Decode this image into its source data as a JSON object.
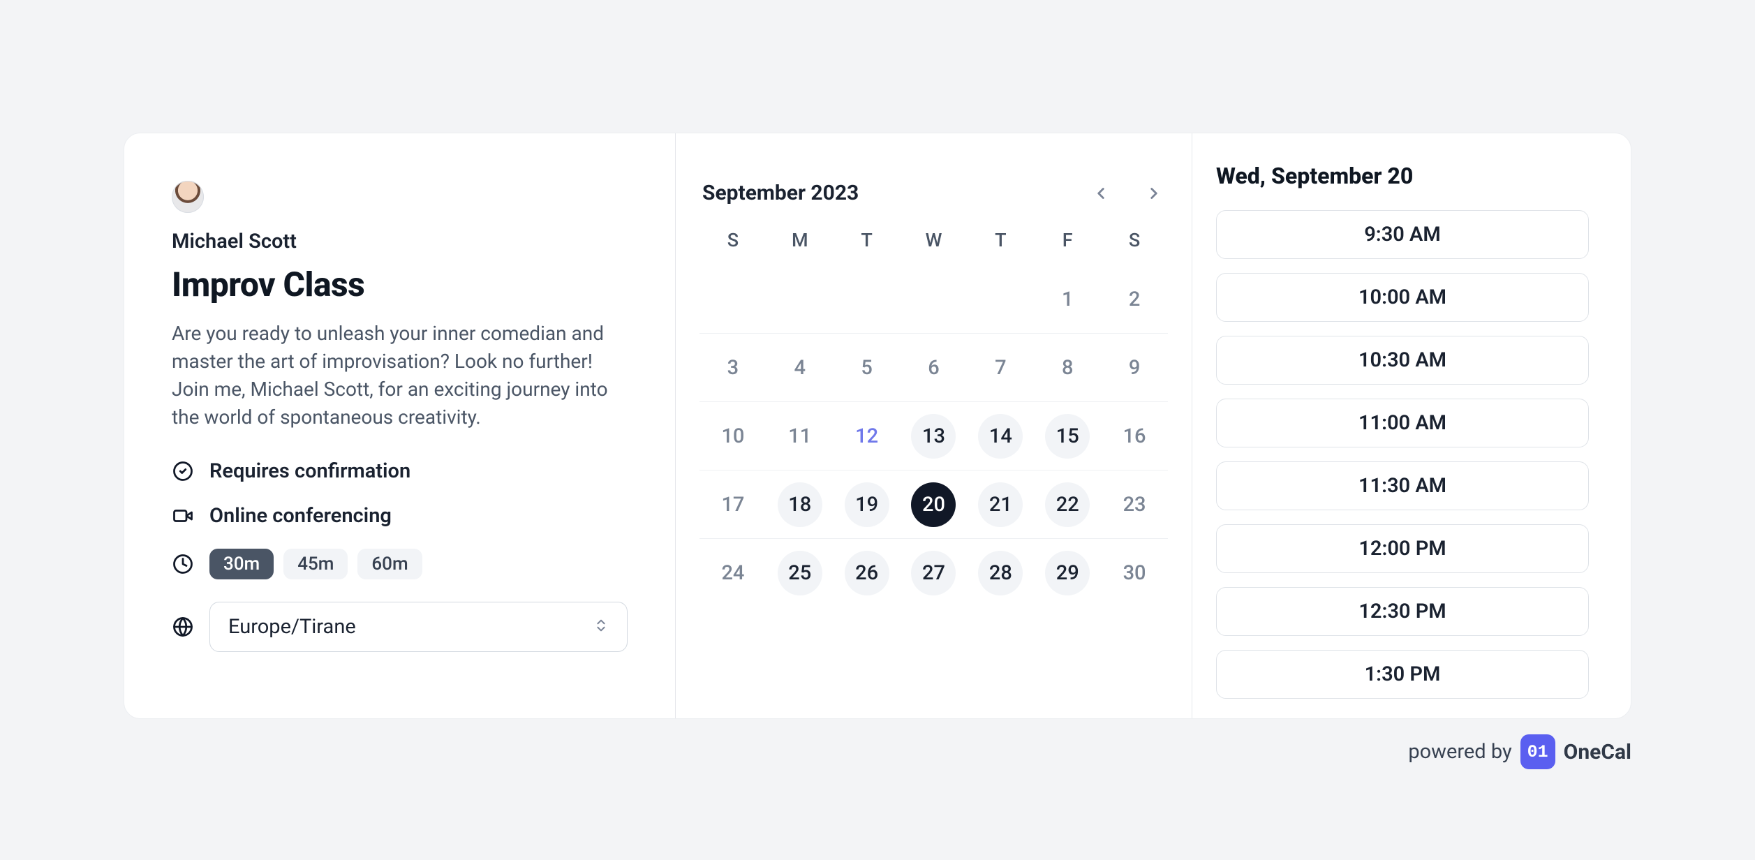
{
  "host": {
    "name": "Michael Scott"
  },
  "event": {
    "title": "Improv Class",
    "description": "Are you ready to unleash your inner comedian and master the art of improvisation? Look no further! Join me, Michael Scott, for an exciting journey into the world of spontaneous creativity."
  },
  "features": {
    "confirmation_label": "Requires confirmation",
    "conferencing_label": "Online conferencing"
  },
  "durations": {
    "options": [
      "30m",
      "45m",
      "60m"
    ],
    "selected_index": 0
  },
  "timezone": {
    "value": "Europe/Tirane"
  },
  "calendar": {
    "month_label": "September 2023",
    "dow": [
      "S",
      "M",
      "T",
      "W",
      "T",
      "F",
      "S"
    ],
    "weeks": [
      [
        {
          "n": "",
          "s": "empty"
        },
        {
          "n": "",
          "s": "empty"
        },
        {
          "n": "",
          "s": "empty"
        },
        {
          "n": "",
          "s": "empty"
        },
        {
          "n": "",
          "s": "empty"
        },
        {
          "n": "1",
          "s": "muted"
        },
        {
          "n": "2",
          "s": "muted"
        }
      ],
      [
        {
          "n": "3",
          "s": "muted"
        },
        {
          "n": "4",
          "s": "muted"
        },
        {
          "n": "5",
          "s": "muted"
        },
        {
          "n": "6",
          "s": "muted"
        },
        {
          "n": "7",
          "s": "muted"
        },
        {
          "n": "8",
          "s": "muted"
        },
        {
          "n": "9",
          "s": "muted"
        }
      ],
      [
        {
          "n": "10",
          "s": "muted"
        },
        {
          "n": "11",
          "s": "muted"
        },
        {
          "n": "12",
          "s": "today-link"
        },
        {
          "n": "13",
          "s": "avail"
        },
        {
          "n": "14",
          "s": "avail"
        },
        {
          "n": "15",
          "s": "avail"
        },
        {
          "n": "16",
          "s": "muted"
        }
      ],
      [
        {
          "n": "17",
          "s": "muted"
        },
        {
          "n": "18",
          "s": "avail"
        },
        {
          "n": "19",
          "s": "avail"
        },
        {
          "n": "20",
          "s": "selected"
        },
        {
          "n": "21",
          "s": "avail"
        },
        {
          "n": "22",
          "s": "avail"
        },
        {
          "n": "23",
          "s": "muted"
        }
      ],
      [
        {
          "n": "24",
          "s": "muted"
        },
        {
          "n": "25",
          "s": "avail"
        },
        {
          "n": "26",
          "s": "avail"
        },
        {
          "n": "27",
          "s": "avail"
        },
        {
          "n": "28",
          "s": "avail"
        },
        {
          "n": "29",
          "s": "avail"
        },
        {
          "n": "30",
          "s": "muted"
        }
      ]
    ]
  },
  "slots": {
    "date_label": "Wed, September 20",
    "times": [
      "9:30 AM",
      "10:00 AM",
      "10:30 AM",
      "11:00 AM",
      "11:30 AM",
      "12:00 PM",
      "12:30 PM",
      "1:30 PM"
    ]
  },
  "footer": {
    "powered_by": "powered by",
    "badge_text": "01",
    "brand": "OneCal"
  }
}
